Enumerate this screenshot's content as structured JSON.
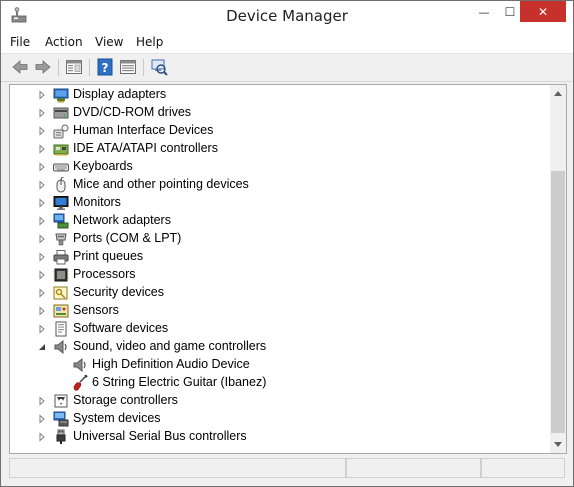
{
  "window": {
    "title": "Device Manager",
    "controls": {
      "minimize": "—",
      "maximize": "☐",
      "close": "✕"
    }
  },
  "menu": [
    "File",
    "Action",
    "View",
    "Help"
  ],
  "toolbar_icons": [
    "back-icon",
    "forward-icon",
    "properties-pane-icon",
    "help-icon",
    "view-icon",
    "scan-hardware-icon"
  ],
  "tree": {
    "items": [
      {
        "label": "Display adapters",
        "icon": "display-adapter-icon",
        "expanded": false,
        "level": 0
      },
      {
        "label": "DVD/CD-ROM drives",
        "icon": "dvd-drive-icon",
        "expanded": false,
        "level": 0
      },
      {
        "label": "Human Interface Devices",
        "icon": "hid-icon",
        "expanded": false,
        "level": 0
      },
      {
        "label": "IDE ATA/ATAPI controllers",
        "icon": "ide-controller-icon",
        "expanded": false,
        "level": 0
      },
      {
        "label": "Keyboards",
        "icon": "keyboard-icon",
        "expanded": false,
        "level": 0
      },
      {
        "label": "Mice and other pointing devices",
        "icon": "mouse-icon",
        "expanded": false,
        "level": 0
      },
      {
        "label": "Monitors",
        "icon": "monitor-icon",
        "expanded": false,
        "level": 0
      },
      {
        "label": "Network adapters",
        "icon": "network-adapter-icon",
        "expanded": false,
        "level": 0
      },
      {
        "label": "Ports (COM & LPT)",
        "icon": "port-icon",
        "expanded": false,
        "level": 0
      },
      {
        "label": "Print queues",
        "icon": "printer-icon",
        "expanded": false,
        "level": 0
      },
      {
        "label": "Processors",
        "icon": "processor-icon",
        "expanded": false,
        "level": 0
      },
      {
        "label": "Security devices",
        "icon": "security-key-icon",
        "expanded": false,
        "level": 0
      },
      {
        "label": "Sensors",
        "icon": "sensor-icon",
        "expanded": false,
        "level": 0
      },
      {
        "label": "Software devices",
        "icon": "software-device-icon",
        "expanded": false,
        "level": 0
      },
      {
        "label": "Sound, video and game controllers",
        "icon": "speaker-icon",
        "expanded": true,
        "level": 0
      },
      {
        "label": "High Definition Audio Device",
        "icon": "speaker-icon",
        "level": 1
      },
      {
        "label": "6 String Electric Guitar (Ibanez)",
        "icon": "guitar-icon",
        "level": 1
      },
      {
        "label": "Storage controllers",
        "icon": "storage-controller-icon",
        "expanded": false,
        "level": 0
      },
      {
        "label": "System devices",
        "icon": "system-device-icon",
        "expanded": false,
        "level": 0
      },
      {
        "label": "Universal Serial Bus controllers",
        "icon": "usb-icon",
        "expanded": false,
        "level": 0
      }
    ]
  },
  "colors": {
    "close_button": "#c7312b",
    "scrollbar_thumb": "#cdcdcd"
  }
}
